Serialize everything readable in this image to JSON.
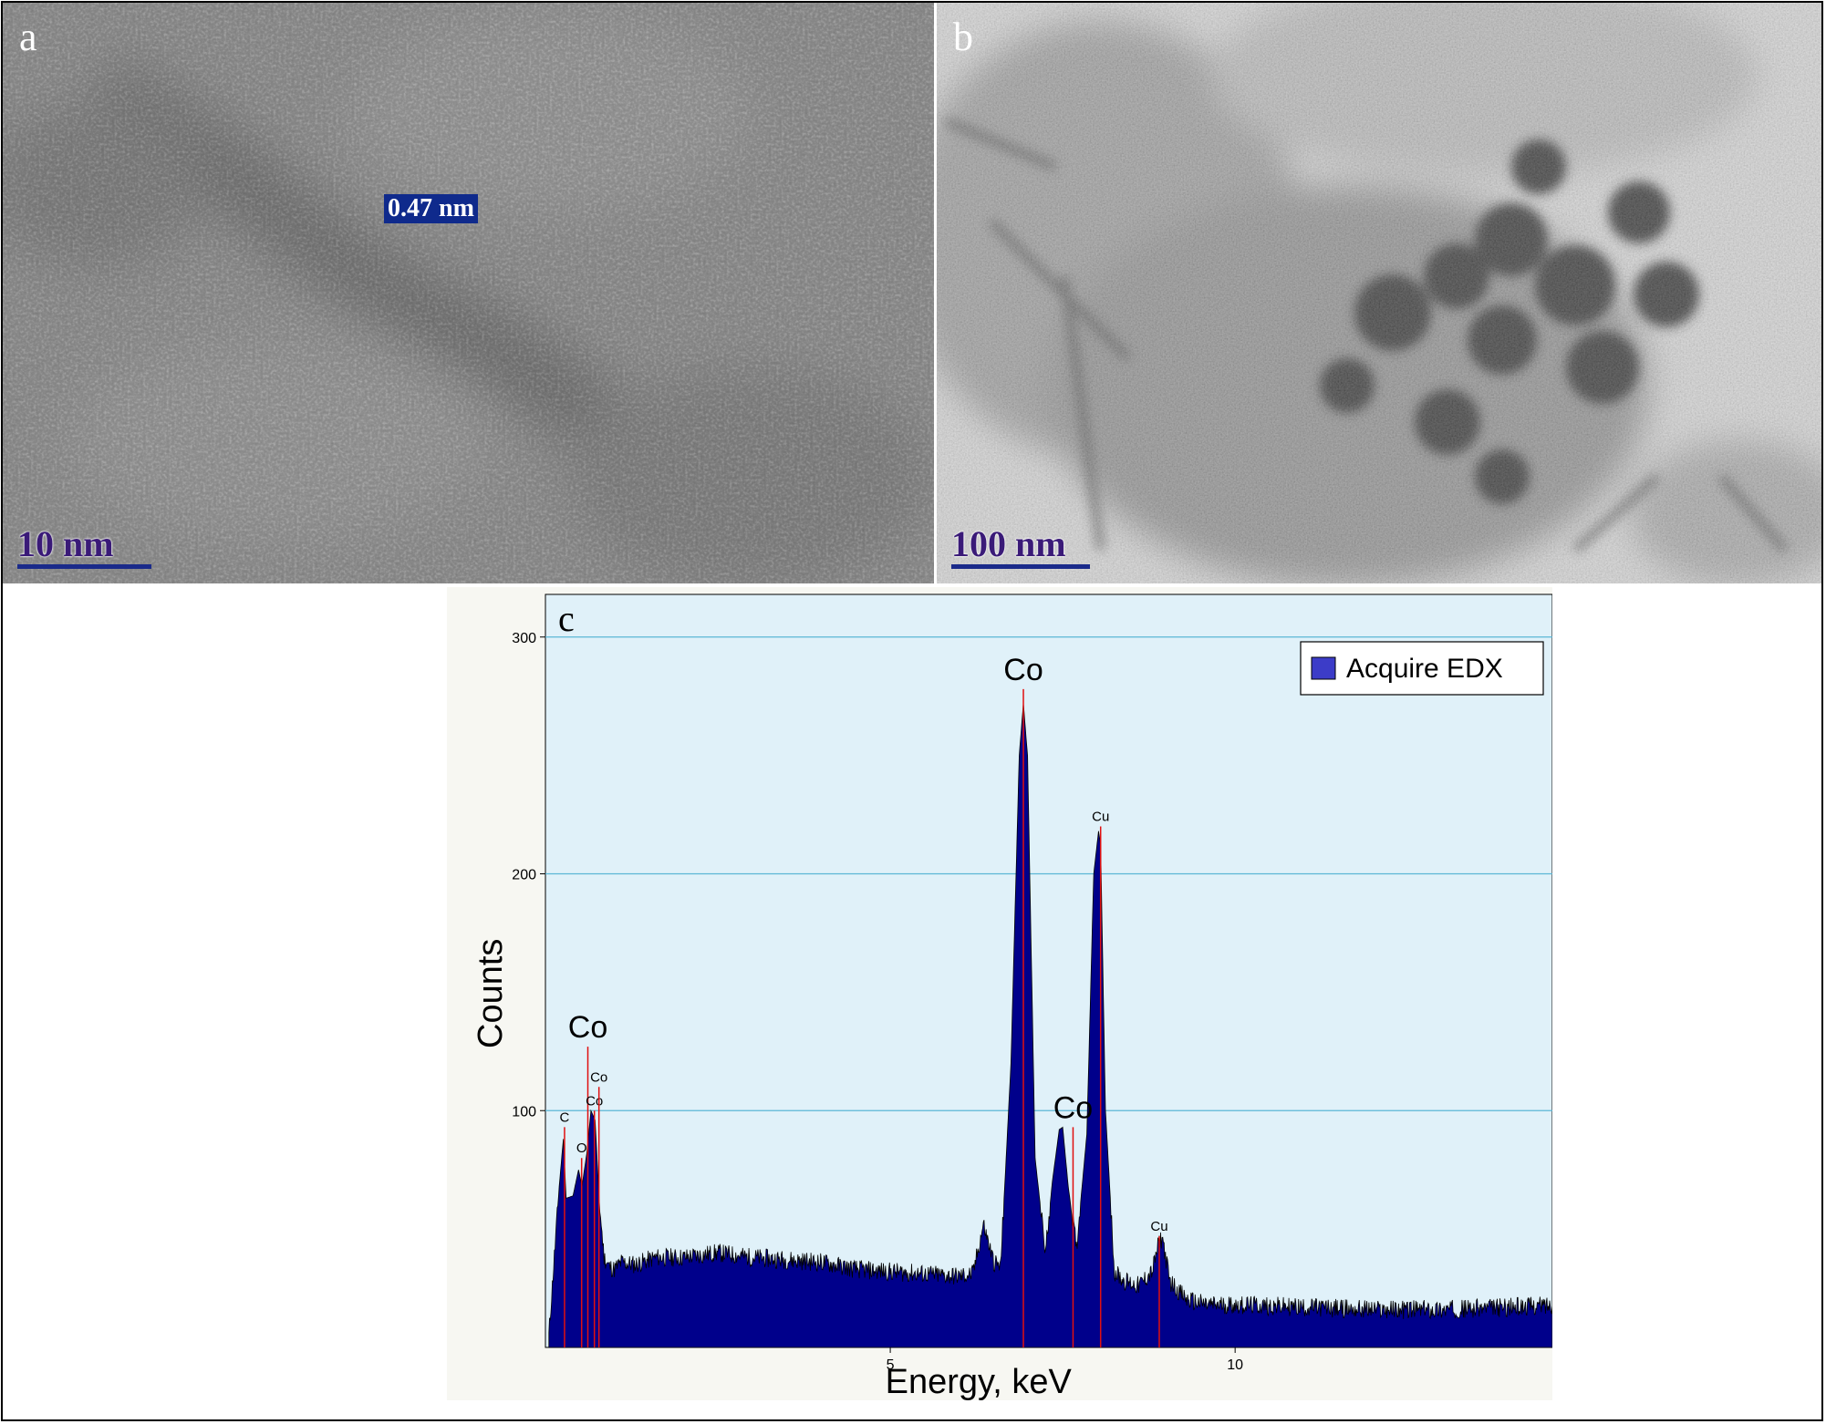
{
  "panels": {
    "a": {
      "letter": "a",
      "scale_label": "10 nm",
      "lattice_label": "0.47 nm"
    },
    "b": {
      "letter": "b",
      "scale_label": "100 nm"
    }
  },
  "chart_data": {
    "type": "area",
    "panel_letter": "c",
    "xlabel": "Energy, keV",
    "ylabel": "Counts",
    "xlim": [
      0,
      14.6
    ],
    "ylim": [
      0,
      318
    ],
    "x_ticks": [
      5,
      10
    ],
    "y_ticks": [
      100,
      200,
      300
    ],
    "grid": "horizontal",
    "legend": {
      "position": "top-right",
      "entries": [
        "Acquire EDX"
      ]
    },
    "series": [
      {
        "name": "Acquire EDX",
        "color": "#00008b",
        "x": [
          0.05,
          0.2,
          0.26,
          0.3,
          0.4,
          0.48,
          0.53,
          0.6,
          0.66,
          0.72,
          0.78,
          0.85,
          0.93,
          1.0,
          1.1,
          1.3,
          1.6,
          2.0,
          2.5,
          3.0,
          3.5,
          4.0,
          4.5,
          5.0,
          5.5,
          6.0,
          6.2,
          6.35,
          6.5,
          6.6,
          6.75,
          6.87,
          6.93,
          6.99,
          7.1,
          7.25,
          7.35,
          7.45,
          7.5,
          7.58,
          7.7,
          7.85,
          7.95,
          8.02,
          8.05,
          8.12,
          8.25,
          8.4,
          8.6,
          8.8,
          8.9,
          8.95,
          9.05,
          9.3,
          9.6,
          10.0,
          11.0,
          12.0,
          13.0,
          14.0,
          14.6
        ],
        "values": [
          5,
          68,
          88,
          63,
          64,
          75,
          68,
          82,
          100,
          96,
          62,
          38,
          34,
          33,
          36,
          35,
          38,
          38,
          40,
          38,
          37,
          36,
          33,
          32,
          31,
          30,
          31,
          52,
          36,
          34,
          120,
          250,
          272,
          250,
          80,
          40,
          70,
          92,
          93,
          68,
          42,
          90,
          200,
          218,
          212,
          100,
          32,
          28,
          26,
          32,
          45,
          46,
          28,
          20,
          18,
          18,
          17,
          16,
          16,
          17,
          18
        ]
      }
    ],
    "peak_markers": [
      {
        "label": "C",
        "x": 0.277,
        "height": 93,
        "label_size": "small"
      },
      {
        "label": "O",
        "x": 0.525,
        "height": 80,
        "label_size": "small"
      },
      {
        "label": "Co",
        "x": 0.615,
        "height": 127,
        "label_size": "large"
      },
      {
        "label": "Co",
        "x": 0.71,
        "height": 100,
        "label_size": "small"
      },
      {
        "label": "Co",
        "x": 0.776,
        "height": 110,
        "label_size": "small"
      },
      {
        "label": "Co",
        "x": 6.93,
        "height": 278,
        "label_size": "large"
      },
      {
        "label": "Co",
        "x": 7.65,
        "height": 93,
        "label_size": "large"
      },
      {
        "label": "Cu",
        "x": 8.05,
        "height": 220,
        "label_size": "small"
      },
      {
        "label": "Cu",
        "x": 8.9,
        "height": 47,
        "label_size": "small"
      }
    ]
  },
  "colors": {
    "plot_background": "#e0f1f9",
    "gridline": "#5bb6d6",
    "spectrum_fill": "#00008b",
    "marker_line": "#e01010"
  }
}
